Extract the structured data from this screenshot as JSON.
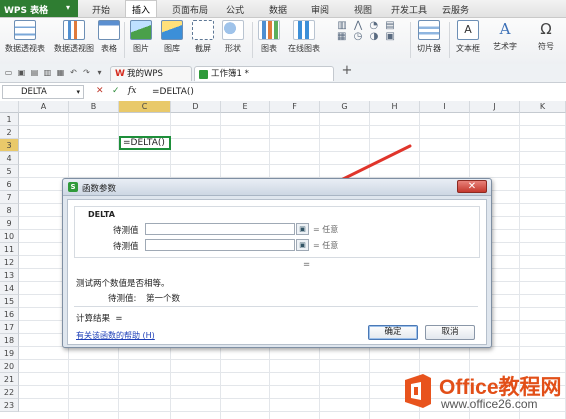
{
  "app": {
    "name": "WPS 表格"
  },
  "menu": [
    "开始",
    "插入",
    "页面布局",
    "公式",
    "数据",
    "审阅",
    "视图",
    "开发工具",
    "云服务"
  ],
  "menu_active_index": 1,
  "ribbon": {
    "items": [
      "数据透视表",
      "数据透视图",
      "表格",
      "图片",
      "图库",
      "截屏",
      "形状",
      "图表",
      "在线图表",
      "切片器",
      "文本框",
      "艺术字",
      "符号"
    ]
  },
  "tabs": [
    {
      "label": "我的WPS",
      "active": false
    },
    {
      "label": "工作簿1 *",
      "active": true
    }
  ],
  "new_tab_glyph": "+",
  "formula_bar": {
    "name_box": "DELTA",
    "cancel": "✕",
    "accept": "✓",
    "fx": "fx",
    "formula": "=DELTA()"
  },
  "grid": {
    "columns": [
      "A",
      "B",
      "C",
      "D",
      "E",
      "F",
      "G",
      "H",
      "I",
      "J",
      "K"
    ],
    "selected_column": "C",
    "rows": [
      "1",
      "2",
      "3",
      "4",
      "5",
      "6",
      "7",
      "8",
      "9",
      "10",
      "11",
      "12",
      "13",
      "14",
      "15",
      "16",
      "17",
      "18",
      "19",
      "20",
      "21",
      "22",
      "23"
    ],
    "selected_row": "3",
    "active_cell_text": "=DELTA()"
  },
  "dialog": {
    "title": "函数参数",
    "close": "✕",
    "function_name": "DELTA",
    "params": [
      {
        "label": "待测值",
        "hint": "任意"
      },
      {
        "label": "待测值",
        "hint": "任意"
      }
    ],
    "equals": "=",
    "result_eq": "=",
    "description": "测试两个数值是否相等。",
    "param_desc_label": "待测值:",
    "param_desc_text": "第一个数",
    "result_label": "计算结果",
    "help_link": "有关该函数的帮助 (H)",
    "ok": "确定",
    "cancel": "取消"
  },
  "watermark": {
    "brand": "Office教程网",
    "url": "www.office26.com"
  },
  "colors": {
    "accent_green": "#2f7d32",
    "arrow_red": "#e0352b",
    "active_cell_border": "#1e8f3a",
    "header_selected": "#e9c96a"
  }
}
